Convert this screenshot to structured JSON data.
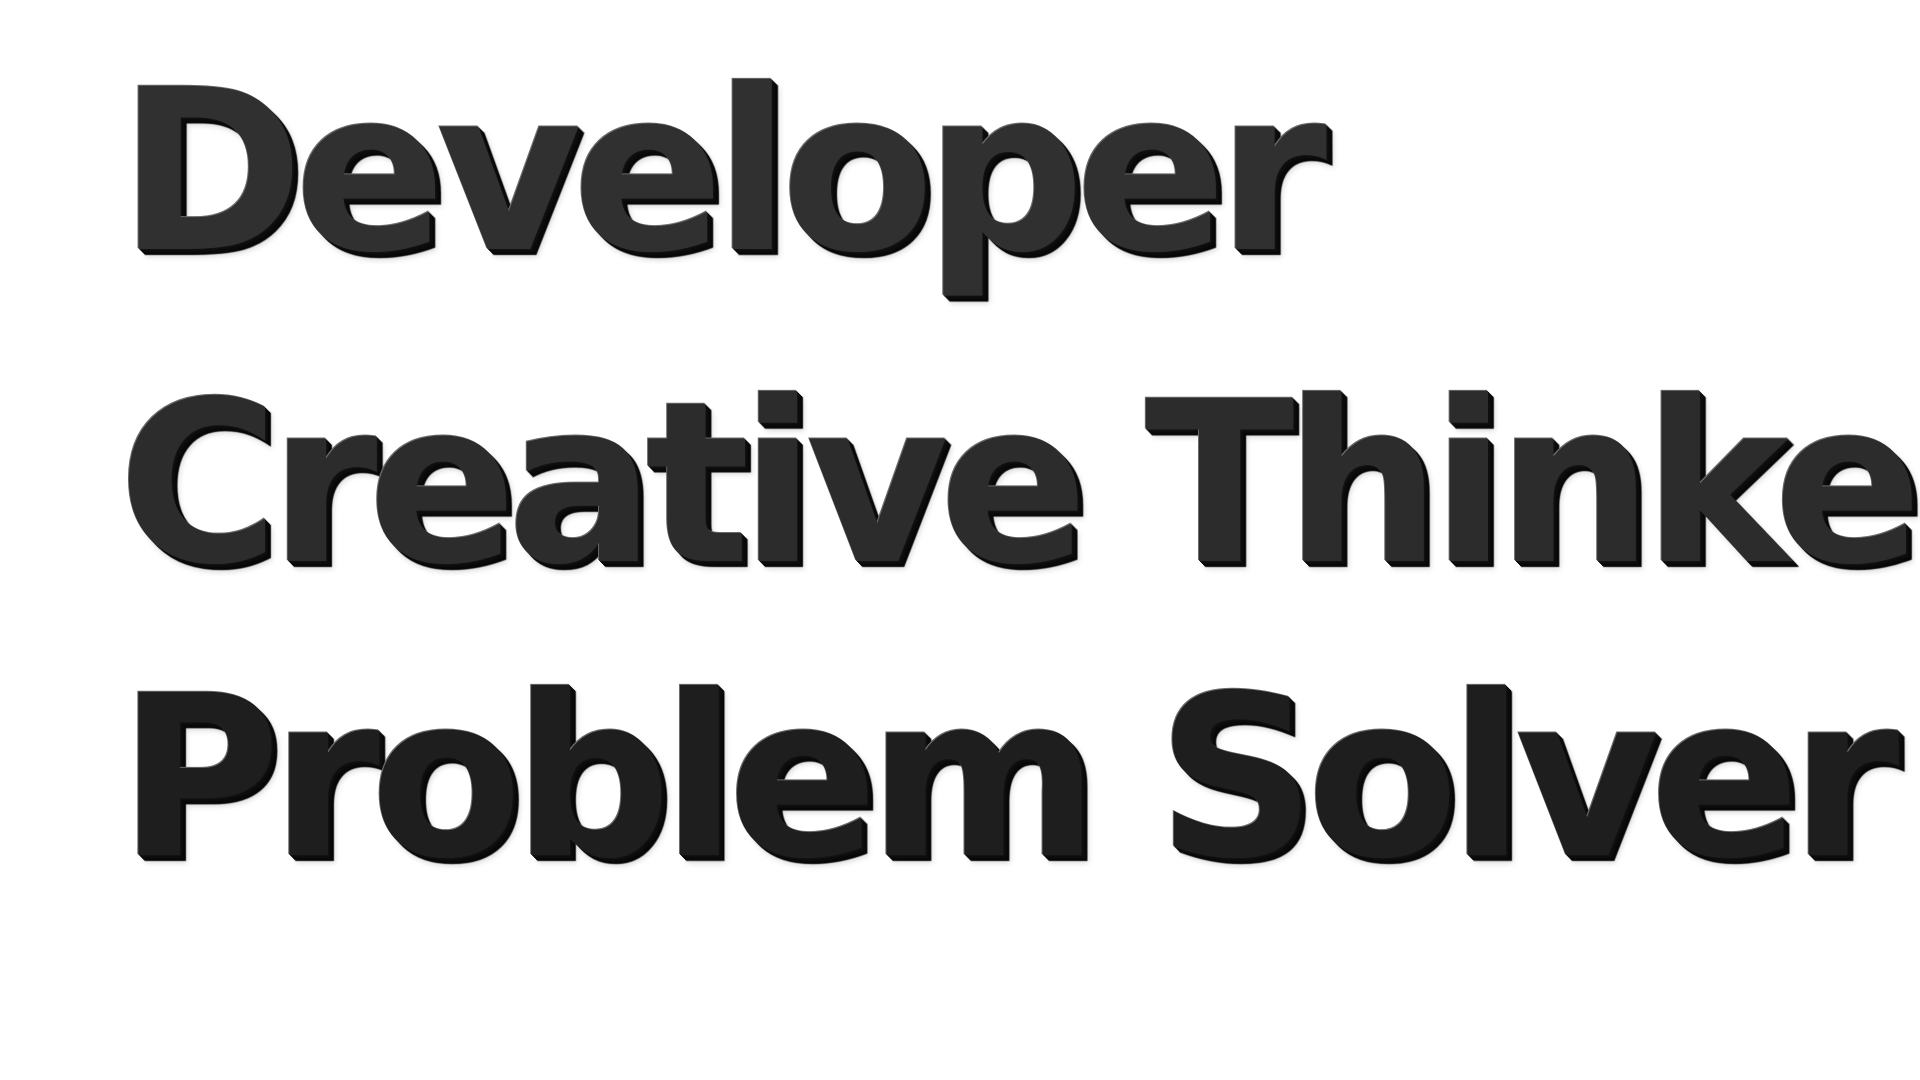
{
  "lines": [
    {
      "text": "Developer"
    },
    {
      "text": "Creative Thinker"
    },
    {
      "text": "Problem Solver"
    }
  ],
  "colors": {
    "background": "#ffffff",
    "text": "#2a2a2a"
  }
}
